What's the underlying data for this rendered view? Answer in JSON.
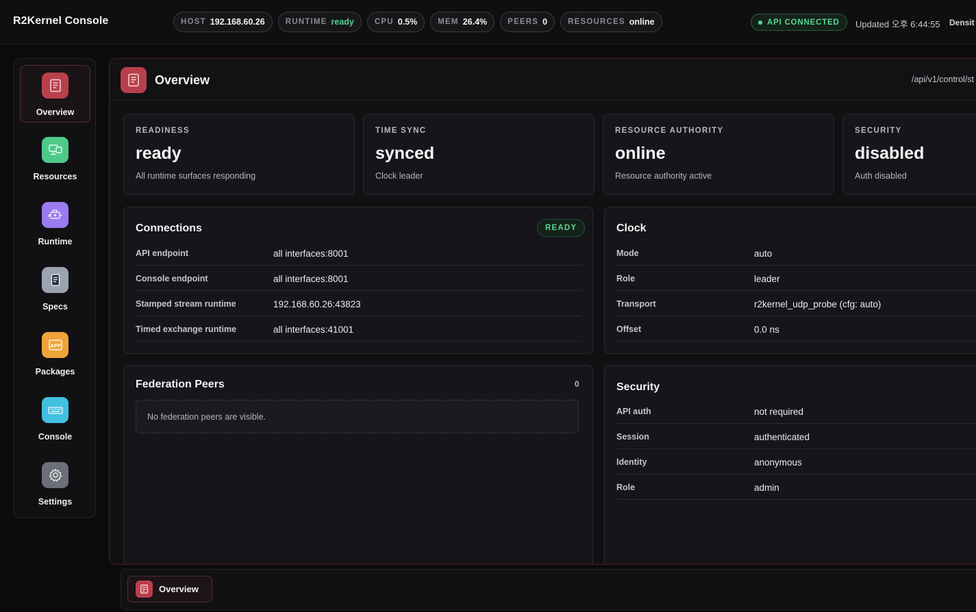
{
  "app": {
    "title": "R2Kernel Console"
  },
  "status_pills": [
    {
      "key": "HOST",
      "value": "192.168.60.26"
    },
    {
      "key": "RUNTIME",
      "value": "ready"
    },
    {
      "key": "CPU",
      "value": "0.5%"
    },
    {
      "key": "MEM",
      "value": "26.4%"
    },
    {
      "key": "PEERS",
      "value": "0"
    },
    {
      "key": "RESOURCES",
      "value": "online"
    }
  ],
  "api_status": {
    "label": "API CONNECTED",
    "color": "#59d892"
  },
  "updated": "Updated 오후 6:44:55",
  "density_label": "Densit",
  "sidebar": {
    "items": [
      {
        "label": "Overview",
        "icon": "document-icon",
        "color": "#b8404b",
        "active": true
      },
      {
        "label": "Resources",
        "icon": "devices-icon",
        "color": "#4fc98a"
      },
      {
        "label": "Runtime",
        "icon": "engine-icon",
        "color": "#9b7bf0"
      },
      {
        "label": "Specs",
        "icon": "spec-sheet-icon",
        "color": "#9aa3b2"
      },
      {
        "label": "Packages",
        "icon": "app-package-icon",
        "color": "#f0a33a"
      },
      {
        "label": "Console",
        "icon": "keyboard-icon",
        "color": "#42c0e0"
      },
      {
        "label": "Settings",
        "icon": "gear-icon",
        "color": "#6d6f78"
      }
    ]
  },
  "main": {
    "title": "Overview",
    "api_path": "/api/v1/control/st",
    "stats": [
      {
        "label": "READINESS",
        "value": "ready",
        "sub": "All runtime surfaces responding"
      },
      {
        "label": "TIME SYNC",
        "value": "synced",
        "sub": "Clock leader"
      },
      {
        "label": "RESOURCE AUTHORITY",
        "value": "online",
        "sub": "Resource authority active"
      },
      {
        "label": "SECURITY",
        "value": "disabled",
        "sub": "Auth disabled"
      }
    ],
    "connections": {
      "title": "Connections",
      "badge": "READY",
      "rows": [
        {
          "k": "API endpoint",
          "v": "all interfaces:8001"
        },
        {
          "k": "Console endpoint",
          "v": "all interfaces:8001"
        },
        {
          "k": "Stamped stream runtime",
          "v": "192.168.60.26:43823"
        },
        {
          "k": "Timed exchange runtime",
          "v": "all interfaces:41001"
        }
      ]
    },
    "clock": {
      "title": "Clock",
      "rows": [
        {
          "k": "Mode",
          "v": "auto"
        },
        {
          "k": "Role",
          "v": "leader"
        },
        {
          "k": "Transport",
          "v": "r2kernel_udp_probe (cfg: auto)"
        },
        {
          "k": "Offset",
          "v": "0.0 ns"
        }
      ]
    },
    "federation": {
      "title": "Federation Peers",
      "count": "0",
      "empty": "No federation peers are visible."
    },
    "security": {
      "title": "Security",
      "rows": [
        {
          "k": "API auth",
          "v": "not required"
        },
        {
          "k": "Session",
          "v": "authenticated"
        },
        {
          "k": "Identity",
          "v": "anonymous"
        },
        {
          "k": "Role",
          "v": "admin"
        }
      ]
    }
  },
  "dock": {
    "tab_label": "Overview"
  }
}
